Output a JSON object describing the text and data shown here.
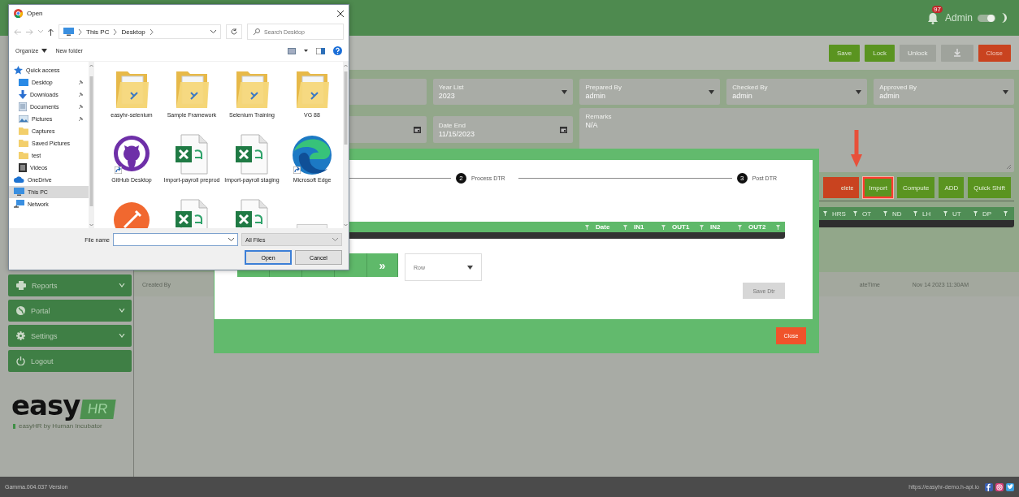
{
  "header": {
    "notifications": {
      "badge": "97"
    },
    "user": "Admin",
    "theme_toggle": {
      "on": true
    }
  },
  "toolbar": [
    {
      "label": "Save",
      "disabled": false
    },
    {
      "label": "Lock",
      "disabled": false
    },
    {
      "label": "Unlock",
      "disabled": true
    },
    {
      "kind": "icon",
      "disabled": true
    },
    {
      "label": "Close",
      "disabled": false
    }
  ],
  "form": {
    "rows": [
      [
        {
          "kind": "text"
        },
        {
          "kind": "select",
          "label": "Year List",
          "value": "2023"
        },
        {
          "kind": "select",
          "label": "Prepared By",
          "value": "admin"
        },
        {
          "kind": "select",
          "label": "Checked By",
          "value": "admin"
        },
        {
          "kind": "select",
          "label": "Approved By",
          "value": "admin"
        }
      ],
      [
        {
          "kind": "date"
        },
        {
          "kind": "date",
          "label": "Date End",
          "value": "11/15/2023"
        },
        {
          "kind": "textarea",
          "label": "Remarks",
          "value": "N/A"
        }
      ]
    ]
  },
  "actions": [
    {
      "label": "elete",
      "highlighted": false
    },
    {
      "label": "Import",
      "highlighted": true
    },
    {
      "label": "Compute",
      "highlighted": false
    },
    {
      "label": "ADD",
      "highlighted": false
    },
    {
      "label": "Quick Shift",
      "highlighted": false
    }
  ],
  "table": {
    "columns": [
      "HRS",
      "OT",
      "ND",
      "LH",
      "UT",
      "DP"
    ]
  },
  "record_info": {
    "created_label": "Created By",
    "datetime_label": "ateTime",
    "datetime_value": "Nov 14 2023 11:30AM"
  },
  "sidebar": {
    "items": [
      {
        "label": "Reports",
        "expandable": true
      },
      {
        "label": "Portal",
        "expandable": true
      },
      {
        "label": "Settings",
        "expandable": true
      },
      {
        "label": "Logout",
        "expandable": false
      }
    ],
    "logo": {
      "word": "easy",
      "badge": "HR",
      "tagline": "easyHR by Human Incubator"
    }
  },
  "footer": {
    "version": "Gamma.004.037 Version",
    "link": "https://easyhr-demo.h-api.io"
  },
  "modal": {
    "steps": [
      {
        "number": "2",
        "label": "Process DTR"
      },
      {
        "number": "3",
        "label": "Post DTR"
      }
    ],
    "table": {
      "columns": [
        "Date",
        "IN1",
        "OUT1",
        "IN2",
        "OUT2"
      ]
    },
    "pager": {
      "last": "»"
    },
    "rows_select": {
      "value": "Row"
    },
    "save_button": {
      "label": "Save Dtr",
      "disabled": true
    },
    "close_button": {
      "label": "Close"
    }
  },
  "file_dialog": {
    "title": "Open",
    "path": [
      "This PC",
      "Desktop"
    ],
    "search": {
      "placeholder": "Search Desktop"
    },
    "toolbar": [
      {
        "label": "Organize",
        "menu": true
      },
      {
        "label": "New folder",
        "menu": false
      }
    ],
    "nav": [
      {
        "label": "Quick access",
        "selected": false,
        "children": [
          {
            "label": "Desktop",
            "selected": false,
            "pinned": true
          },
          {
            "label": "Downloads",
            "selected": false,
            "pinned": true
          },
          {
            "label": "Documents",
            "selected": false,
            "pinned": true
          },
          {
            "label": "Pictures",
            "selected": false,
            "pinned": true
          },
          {
            "label": "Captures",
            "selected": false,
            "pinned": false
          },
          {
            "label": "Saved Pictures",
            "selected": false,
            "pinned": false
          },
          {
            "label": "test",
            "selected": false,
            "pinned": false
          },
          {
            "label": "Videos",
            "selected": false,
            "pinned": false
          }
        ]
      },
      {
        "label": "OneDrive",
        "selected": false
      },
      {
        "label": "This PC",
        "selected": true
      },
      {
        "label": "Network",
        "selected": false
      }
    ],
    "items": [
      {
        "kind": "folder",
        "label": "easyhr-selenium",
        "shortcut": false
      },
      {
        "kind": "folder",
        "label": "Sample Framework",
        "shortcut": false
      },
      {
        "kind": "folder",
        "label": "Selenium Training",
        "shortcut": false
      },
      {
        "kind": "folder",
        "label": "VG 88",
        "shortcut": false
      },
      {
        "kind": "app",
        "label": "GitHub Desktop",
        "shortcut": true
      },
      {
        "kind": "spreadsheet",
        "label": "Import-payroll preprod",
        "shortcut": false
      },
      {
        "kind": "spreadsheet",
        "label": "Import-payroll staging",
        "shortcut": false
      },
      {
        "kind": "browser",
        "label": "Microsoft Edge",
        "shortcut": true
      },
      {
        "kind": "tool",
        "shortcut": false
      },
      {
        "kind": "spreadsheet",
        "shortcut": false
      },
      {
        "kind": "spreadsheet",
        "shortcut": false
      },
      {
        "kind": "file",
        "shortcut": false
      }
    ],
    "file_name": {
      "label": "File name"
    },
    "file_type": {
      "value": "All Files"
    },
    "buttons": [
      {
        "label": "Open",
        "default": true
      },
      {
        "label": "Cancel",
        "default": false
      }
    ]
  }
}
